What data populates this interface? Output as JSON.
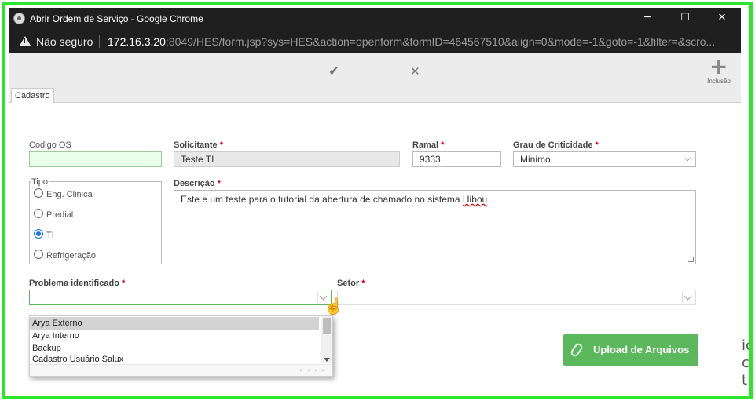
{
  "window": {
    "title": "Abrir Ordem de Serviço - Google Chrome",
    "minimize_icon": "─",
    "maximize_icon": "☐",
    "close_icon": "✕"
  },
  "address_bar": {
    "security_label": "Não seguro",
    "url_host": "172.16.3.20",
    "url_rest": ":8049/HES/form.jsp?sys=HES&action=openform&formID=464567510&align=0&mode=-1&goto=-1&filter=&scro..."
  },
  "toolbar": {
    "confirm_icon": "✔",
    "cancel_icon": "✕",
    "add_icon": "+",
    "add_label": "Inclusão"
  },
  "tabs": [
    {
      "label": "Cadastro"
    }
  ],
  "form": {
    "codigo_os": {
      "label": "Codigo OS",
      "value": ""
    },
    "solicitante": {
      "label": "Solicitante",
      "required": "*",
      "value": "Teste TI"
    },
    "ramal": {
      "label": "Ramal",
      "required": "*",
      "value": "9333"
    },
    "grau_criticidade": {
      "label": "Grau de Criticidade",
      "required": "*",
      "value": "Minimo"
    },
    "tipo": {
      "label": "Tipo",
      "options": [
        {
          "label": "Eng. Clinica"
        },
        {
          "label": "Predial"
        },
        {
          "label": "TI"
        },
        {
          "label": "Refrigeração"
        }
      ],
      "selected": "TI"
    },
    "descricao": {
      "label": "Descrição",
      "required": "*",
      "value_main": "Este e um teste para o tutorial da abertura de chamado no sistema ",
      "value_flagged": "Hibou"
    },
    "problema": {
      "label": "Problema identificado",
      "required": "*",
      "value": "",
      "options": [
        {
          "label": "Arya Externo"
        },
        {
          "label": "Arya Interno"
        },
        {
          "label": "Backup"
        },
        {
          "label": "Cadastro Usuário Salux"
        }
      ],
      "highlighted": "Arya Externo",
      "pager_icons": "« ‹ › »"
    },
    "setor": {
      "label": "Setor",
      "required": "*",
      "value": ""
    },
    "upload": {
      "label": "Upload de Arquivos",
      "icon": "paperclip-icon"
    }
  },
  "colors": {
    "highlight_frame": "#2ee52e",
    "upload_button": "#5cb85c",
    "codigo_os_bg": "#eaffea",
    "required_mark": "#d9001b"
  },
  "background_text": "ic\nc\nt"
}
